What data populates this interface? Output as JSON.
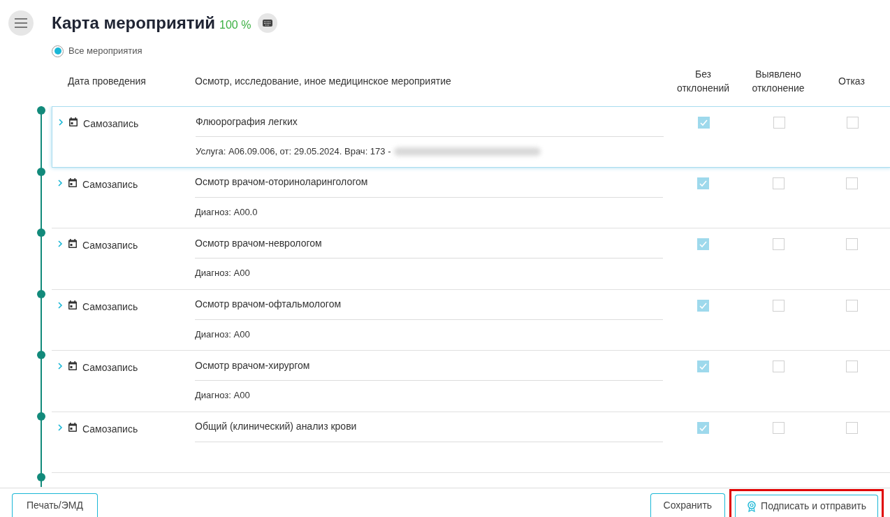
{
  "header": {
    "title": "Карта мероприятий",
    "progress": "100 %"
  },
  "filter": {
    "label": "Все мероприятия",
    "selected": true
  },
  "columns": [
    "Дата проведения",
    "Осмотр, исследование, иное медицинское мероприятие",
    "Без отклонений",
    "Выявлено отклонение",
    "Отказ"
  ],
  "rows": [
    {
      "date": "Самозапись",
      "name": "Флюорография легких",
      "detail": "Услуга: А06.09.006, от: 29.05.2024. Врач: 173 -",
      "redacted": true,
      "selected": true,
      "normal": true,
      "deviation": false,
      "refused": false
    },
    {
      "date": "Самозапись",
      "name": "Осмотр врачом-оториноларингологом",
      "detail": "Диагноз: A00.0",
      "redacted": false,
      "selected": false,
      "normal": true,
      "deviation": false,
      "refused": false
    },
    {
      "date": "Самозапись",
      "name": "Осмотр врачом-неврологом",
      "detail": "Диагноз: A00",
      "redacted": false,
      "selected": false,
      "normal": true,
      "deviation": false,
      "refused": false
    },
    {
      "date": "Самозапись",
      "name": "Осмотр врачом-офтальмологом",
      "detail": "Диагноз: A00",
      "redacted": false,
      "selected": false,
      "normal": true,
      "deviation": false,
      "refused": false
    },
    {
      "date": "Самозапись",
      "name": "Осмотр врачом-хирургом",
      "detail": "Диагноз: A00",
      "redacted": false,
      "selected": false,
      "normal": true,
      "deviation": false,
      "refused": false
    },
    {
      "date": "Самозапись",
      "name": "Общий (клинический) анализ крови",
      "redacted": false,
      "selected": false,
      "normal": true,
      "deviation": false,
      "refused": false
    }
  ],
  "footer": {
    "print": "Печать/ЭМД",
    "save": "Сохранить",
    "submit": "Подписать и отправить",
    "submit_highlighted": true
  }
}
